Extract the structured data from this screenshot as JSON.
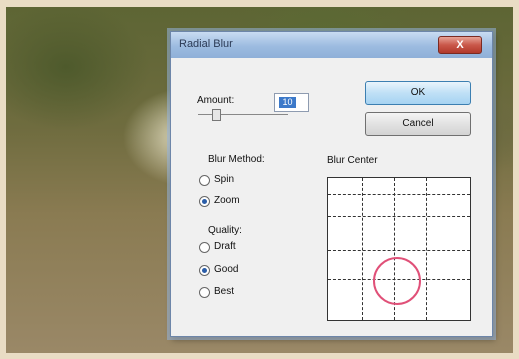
{
  "dialog": {
    "title": "Radial Blur",
    "close_label": "X",
    "amount_label": "Amount:",
    "amount_value": "10",
    "ok_label": "OK",
    "cancel_label": "Cancel",
    "blur_method_label": "Blur Method:",
    "blur_methods": [
      "Spin",
      "Zoom"
    ],
    "blur_method_selected": "Zoom",
    "quality_label": "Quality:",
    "quality_options": [
      "Draft",
      "Good",
      "Best"
    ],
    "quality_selected": "Good",
    "blur_center_label": "Blur Center"
  },
  "colors": {
    "titlebar": "#9cbbe0",
    "close_button": "#c9584a",
    "ok_button": "#a6d3f2",
    "selection_highlight": "#3c79c9",
    "center_ring": "#e05078"
  }
}
